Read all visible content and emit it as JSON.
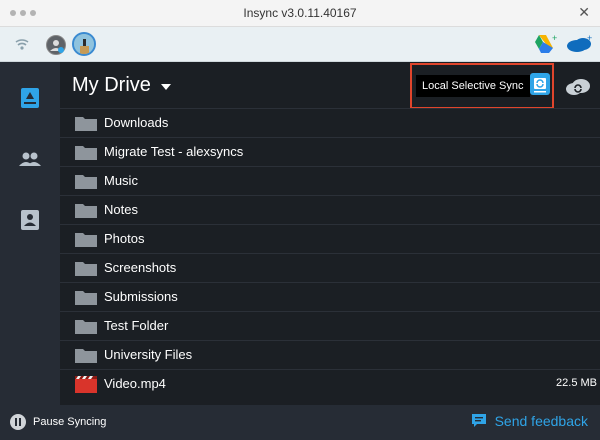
{
  "window": {
    "title": "Insync v3.0.11.40167"
  },
  "accounts": {
    "add_gdrive": "gdrive-plus-icon",
    "add_onedrive": "onedrive-plus-icon"
  },
  "nav": [
    {
      "name": "my-drive-icon",
      "active": true
    },
    {
      "name": "shared-people-icon",
      "active": false
    },
    {
      "name": "contacts-card-icon",
      "active": false
    }
  ],
  "main": {
    "title": "My Drive",
    "tooltip": "Local Selective Sync",
    "items": [
      {
        "type": "folder",
        "name": "Downloads",
        "size": ""
      },
      {
        "type": "folder",
        "name": "Migrate Test - alexsyncs",
        "size": ""
      },
      {
        "type": "folder",
        "name": "Music",
        "size": ""
      },
      {
        "type": "folder",
        "name": "Notes",
        "size": ""
      },
      {
        "type": "folder",
        "name": "Photos",
        "size": ""
      },
      {
        "type": "folder",
        "name": "Screenshots",
        "size": ""
      },
      {
        "type": "folder",
        "name": "Submissions",
        "size": ""
      },
      {
        "type": "folder",
        "name": "Test Folder",
        "size": ""
      },
      {
        "type": "folder",
        "name": "University Files",
        "size": ""
      },
      {
        "type": "video",
        "name": "Video.mp4",
        "size": "22.5 MB"
      }
    ]
  },
  "footer": {
    "pause_label": "Pause Syncing",
    "feedback_label": "Send feedback"
  },
  "colors": {
    "accent": "#2fa4e7",
    "highlight": "#e0452c",
    "folder": "#8e959c",
    "video": "#d9342b"
  }
}
